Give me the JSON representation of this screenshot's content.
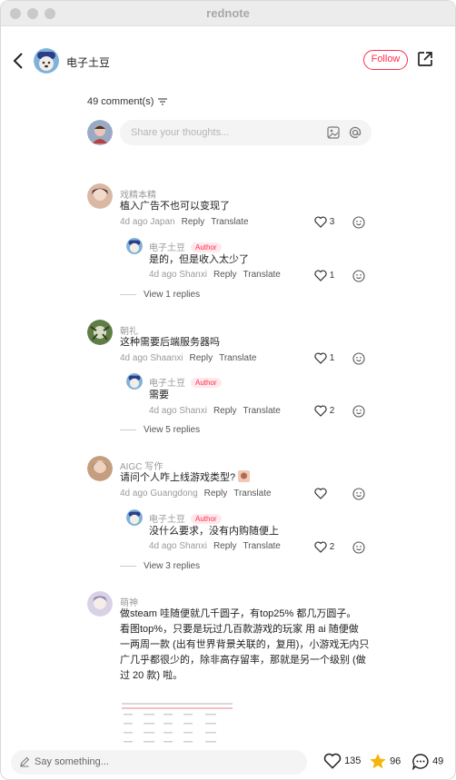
{
  "window": {
    "title": "rednote"
  },
  "header": {
    "author_name": "电子土豆",
    "follow_label": "Follow"
  },
  "comments_count_label": "49 comment(s)",
  "input": {
    "placeholder": "Share your thoughts..."
  },
  "comments": [
    {
      "name": "戏精本精",
      "text": "植入广告不也可以变现了",
      "time": "4d ago",
      "location": "Japan",
      "reply": "Reply",
      "translate": "Translate",
      "likes": "3",
      "sub": {
        "name": "电子土豆",
        "badge": "Author",
        "text": "是的，但是收入太少了",
        "time": "4d ago",
        "location": "Shanxi",
        "reply": "Reply",
        "translate": "Translate",
        "likes": "1"
      },
      "view_replies": "View 1 replies"
    },
    {
      "name": "朝礼",
      "text": "这种需要后端服务器吗",
      "time": "4d ago",
      "location": "Shaanxi",
      "reply": "Reply",
      "translate": "Translate",
      "likes": "1",
      "sub": {
        "name": "电子土豆",
        "badge": "Author",
        "text": "需要",
        "time": "4d ago",
        "location": "Shanxi",
        "reply": "Reply",
        "translate": "Translate",
        "likes": "2"
      },
      "view_replies": "View 5 replies"
    },
    {
      "name": "AIGC 写作",
      "text": "请问个人咋上线游戏类型?",
      "time": "4d ago",
      "location": "Guangdong",
      "reply": "Reply",
      "translate": "Translate",
      "likes": "",
      "sub": {
        "name": "电子土豆",
        "badge": "Author",
        "text": "没什么要求，没有内购随便上",
        "time": "4d ago",
        "location": "Shanxi",
        "reply": "Reply",
        "translate": "Translate",
        "likes": "2"
      },
      "view_replies": "View 3 replies"
    },
    {
      "name": "萌神",
      "lines": [
        "做steam 哇随便就几千圆子，有top25% 都几万圆子。",
        "看图top%，只要是玩过几百款游戏的玩家  用 ai 随便做",
        "一两周一款 (出有世界背景关联的，复用)，小游戏无内只",
        "广几乎都很少的，除非高存留率，那就是另一个级别 (做",
        "过 20 款) 啦。"
      ]
    }
  ],
  "bottom": {
    "say_placeholder": "Say something...",
    "likes": "135",
    "stars": "96",
    "comments": "49"
  },
  "colors": {
    "accent": "#ff2e4d",
    "star": "#f5b50a"
  }
}
